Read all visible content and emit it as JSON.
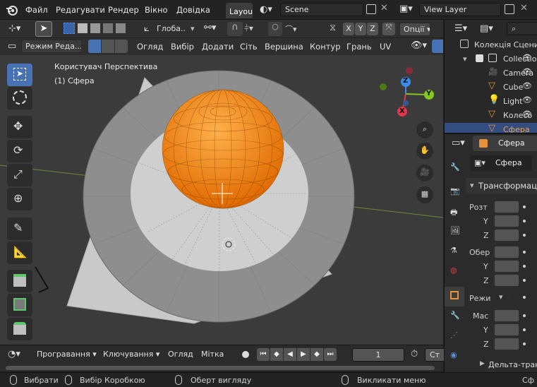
{
  "topbar": {
    "menus": [
      "Файл",
      "Редагувати",
      "Рендер",
      "Вікно",
      "Довідка"
    ],
    "active_workspace": "Layout",
    "scene_name": "Scene",
    "view_layer_name": "View Layer"
  },
  "viewport_header": {
    "transform_orientation": "Глоба..",
    "axes": [
      "X",
      "Y",
      "Z"
    ],
    "options_label": "Опції",
    "mode_label": "Режим Реда...",
    "menus": [
      "Огляд",
      "Вибір",
      "Додати",
      "Сіть",
      "Вершина",
      "Контур",
      "Грань",
      "UV"
    ]
  },
  "viewport": {
    "view_name": "Користувач Перспектива",
    "object_info": "(1) Сфера",
    "gizmo_axes": {
      "x": "X",
      "y": "Y",
      "z": "Z"
    },
    "colors": {
      "background": "#3b3b3b",
      "selection": "#ff8a00",
      "x_axis": "#e3364f",
      "y_axis": "#84c81e",
      "z_axis": "#3d8be9"
    }
  },
  "toolbar": {
    "tools": [
      "select-box",
      "cursor",
      "move",
      "rotate",
      "scale",
      "transform",
      "annotate",
      "measure",
      "add-cube",
      "extrude",
      "inset",
      "bevel"
    ]
  },
  "timeline": {
    "menus": [
      "Програвання",
      "Ключування",
      "Огляд",
      "Мітка"
    ],
    "current_frame": "1",
    "start_label": "Ст"
  },
  "outliner": {
    "root": "Колекція Сцени",
    "items": [
      {
        "label": "Collection",
        "icon": "collection"
      },
      {
        "label": "Camera",
        "icon": "camera"
      },
      {
        "label": "Cube",
        "icon": "mesh"
      },
      {
        "label": "Light",
        "icon": "light"
      },
      {
        "label": "Колесо",
        "icon": "mesh"
      },
      {
        "label": "Сфера",
        "icon": "mesh"
      }
    ]
  },
  "properties": {
    "object_name": "Сфера",
    "panel_name_field": "Сфера",
    "section_title": "Трансформація",
    "groups": [
      {
        "label": "Розт",
        "axes": [
          "",
          "Y",
          "Z"
        ]
      },
      {
        "label": "Обер",
        "axes": [
          "",
          "Y",
          "Z"
        ]
      },
      {
        "label": "Режи",
        "axes": []
      },
      {
        "label": "Мас",
        "axes": [
          "",
          "Y",
          "Z"
        ]
      }
    ],
    "delta_title": "Дельта-трансформація"
  },
  "statusbar": {
    "items": [
      "Вибрати",
      "Вибір Коробкою",
      "Оберт вигляду",
      "Викликати меню"
    ],
    "right_label": "Сф"
  }
}
